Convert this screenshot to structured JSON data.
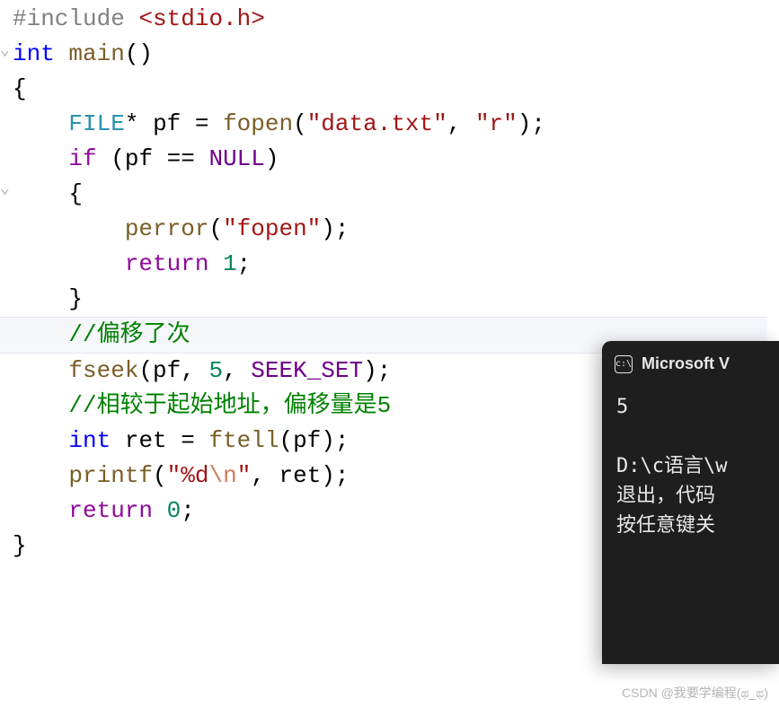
{
  "code": {
    "l1_preproc": "#include ",
    "l1_angle": "<stdio.h>",
    "l2_kw": "int",
    "l2_func": " main",
    "l2_p": "()",
    "l3": "{",
    "l4_type": "FILE",
    "l4_star": "* ",
    "l4_id": "pf = ",
    "l4_fn": "fopen",
    "l4_p1": "(",
    "l4_s1": "\"data.txt\"",
    "l4_c": ", ",
    "l4_s2": "\"r\"",
    "l4_p2": ");",
    "l5_if": "if",
    "l5_p1": " (pf == ",
    "l5_null": "NULL",
    "l5_p2": ")",
    "l6": "{",
    "l7_fn": "perror",
    "l7_p1": "(",
    "l7_s": "\"fopen\"",
    "l7_p2": ");",
    "l8_kw": "return",
    "l8_sp": " ",
    "l8_num": "1",
    "l8_p": ";",
    "l9": "}",
    "l10_comment": "//偏移了次",
    "l11_fn": "fseek",
    "l11_p1": "(pf, ",
    "l11_num": "5",
    "l11_c": ", ",
    "l11_const": "SEEK_SET",
    "l11_p2": ");",
    "l12_comment": "//相较于起始地址，偏移量是5",
    "l13_kw": "int",
    "l13_sp": " ret = ",
    "l13_fn": "ftell",
    "l13_p": "(pf);",
    "l14_fn": "printf",
    "l14_p1": "(",
    "l14_s1": "\"%d",
    "l14_esc": "\\n",
    "l14_s2": "\"",
    "l14_p2": ", ret);",
    "l15_kw": "return",
    "l15_sp": " ",
    "l15_num": "0",
    "l15_p": ";",
    "l16": "}"
  },
  "console": {
    "title": "Microsoft V",
    "output1": "5",
    "output2": "",
    "output3": "D:\\c语言\\w",
    "output4": "退出，代码",
    "output5": "按任意键关",
    "icon_label": "c:\\"
  },
  "watermark": "CSDN @我要学编程(ಥ_ಥ)"
}
